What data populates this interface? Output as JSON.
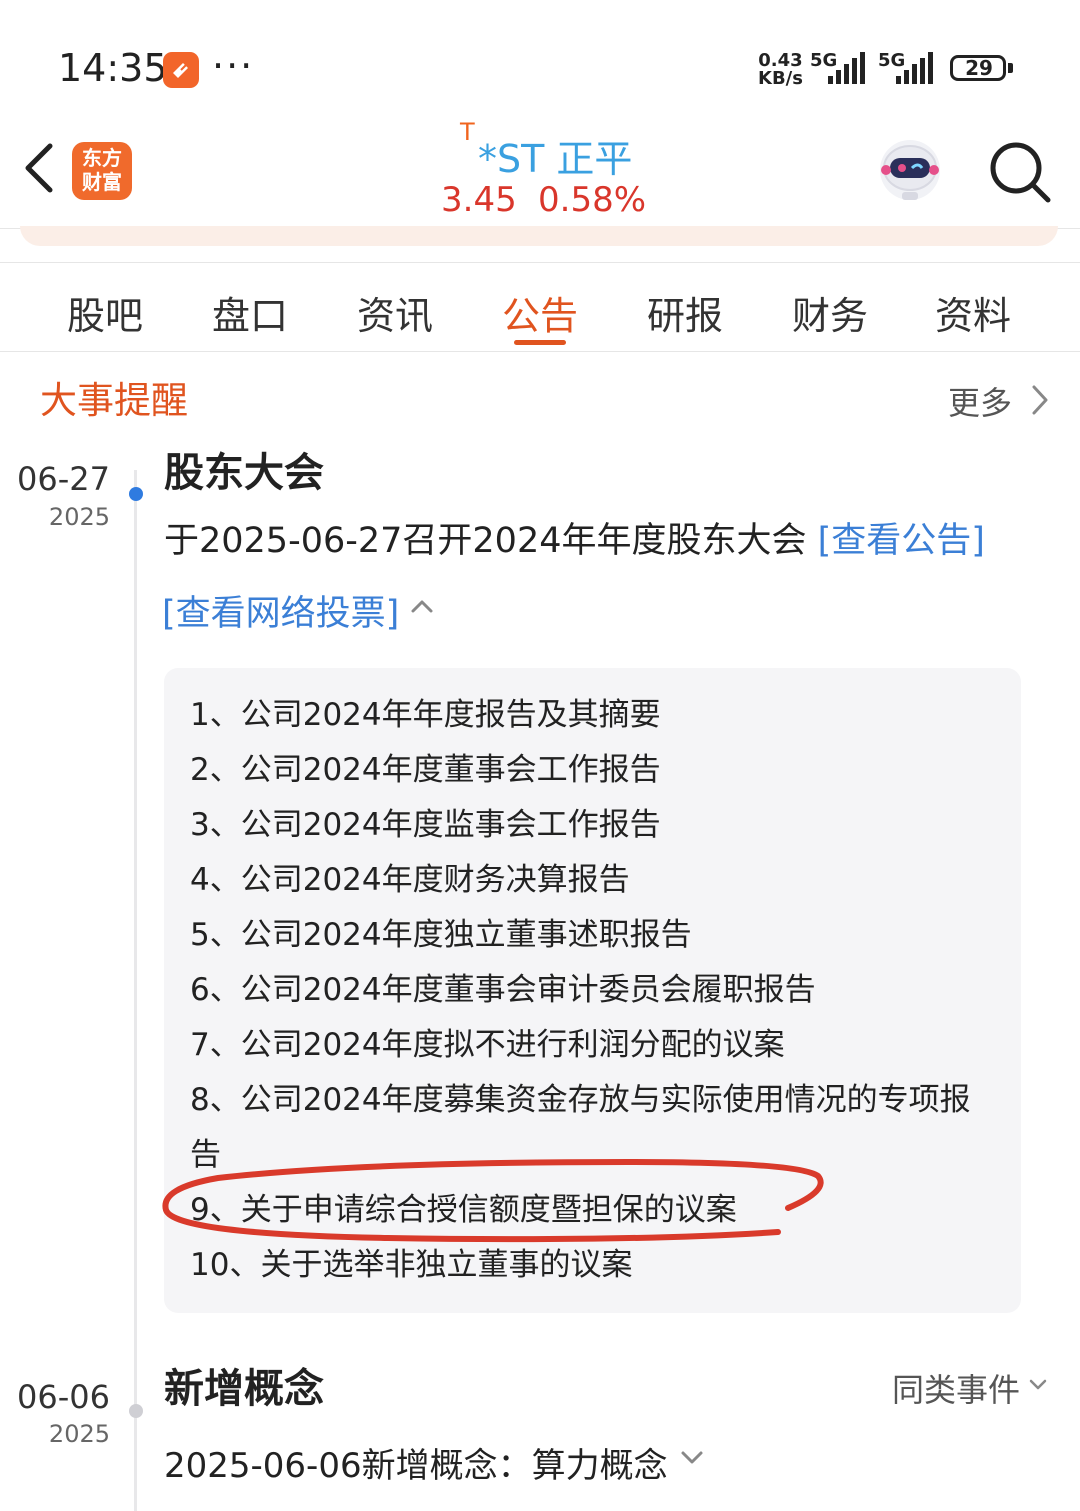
{
  "status_bar": {
    "time": "14:35",
    "more": "···",
    "net_speed_value": "0.43",
    "net_speed_unit": "KB/s",
    "network_1": "5G",
    "network_2": "5G",
    "battery": "29"
  },
  "header": {
    "brand_line1": "东方",
    "brand_line2": "财富",
    "stock_tag": "T",
    "stock_name": "*ST 正平",
    "price": "3.45",
    "change": "0.58%"
  },
  "tabs": [
    {
      "label": "股吧"
    },
    {
      "label": "盘口"
    },
    {
      "label": "资讯"
    },
    {
      "label": "公告",
      "active": true
    },
    {
      "label": "研报"
    },
    {
      "label": "财务"
    },
    {
      "label": "资料"
    }
  ],
  "section": {
    "title": "大事提醒",
    "more": "更多"
  },
  "events": [
    {
      "date": "06-27",
      "year": "2025",
      "title": "股东大会",
      "description": "于2025-06-27召开2024年年度股东大会",
      "notice_link": "[查看公告]",
      "vote_link": "[查看网络投票]",
      "agenda": [
        "1、公司2024年年度报告及其摘要",
        "2、公司2024年度董事会工作报告",
        "3、公司2024年度监事会工作报告",
        "4、公司2024年度财务决算报告",
        "5、公司2024年度独立董事述职报告",
        "6、公司2024年度董事会审计委员会履职报告",
        "7、公司2024年度拟不进行利润分配的议案",
        "8、公司2024年度募集资金存放与实际使用情况的专项报",
        "告",
        "9、关于申请综合授信额度暨担保的议案",
        "10、关于选举非独立董事的议案"
      ]
    },
    {
      "date": "06-06",
      "year": "2025",
      "title": "新增概念",
      "filter": "同类事件",
      "description": "2025-06-06新增概念：算力概念"
    }
  ],
  "colors": {
    "accent": "#e0541f",
    "link": "#3b7fd6",
    "price": "#d9362b",
    "stock_name": "#3aa0e0",
    "highlight_circle": "#d93a2b"
  }
}
